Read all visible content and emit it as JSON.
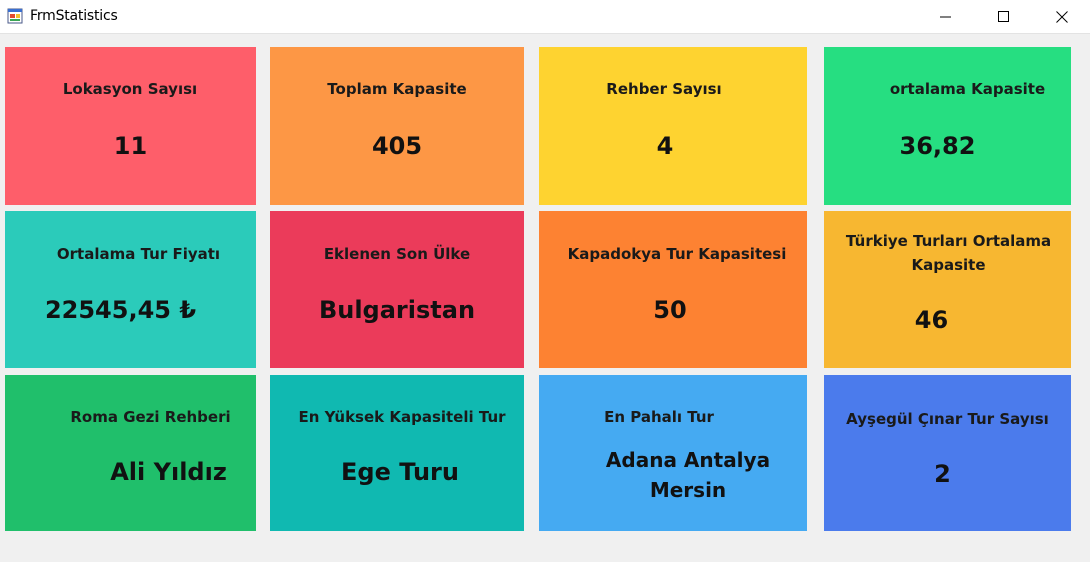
{
  "window": {
    "title": "FrmStatistics",
    "background": "#f0f0f0"
  },
  "cards": [
    {
      "label": "Lokasyon Sayısı",
      "value": "11",
      "color": "#fe5e6a"
    },
    {
      "label": "Toplam Kapasite",
      "value": "405",
      "color": "#fd9745"
    },
    {
      "label": "Rehber Sayısı",
      "value": "4",
      "color": "#fed330"
    },
    {
      "label": "ortalama Kapasite",
      "value": "36,82",
      "color": "#26de81"
    },
    {
      "label": "Ortalama Tur Fiyatı",
      "value": "22545,45 ₺",
      "color": "#2bcbba"
    },
    {
      "label": "Eklenen Son Ülke",
      "value": "Bulgaristan",
      "color": "#eb3b5a"
    },
    {
      "label": "Kapadokya Tur Kapasitesi",
      "value": "50",
      "color": "#fd8232"
    },
    {
      "label": "Türkiye Turları Ortalama Kapasite",
      "value": "46",
      "color": "#f7b731"
    },
    {
      "label": "Roma Gezi Rehberi",
      "value": "Ali Yıldız",
      "color": "#20bf6b"
    },
    {
      "label": "En Yüksek Kapasiteli Tur",
      "value": "Ege Turu",
      "color": "#10b9b1"
    },
    {
      "label": "En Pahalı Tur",
      "value": "Adana Antalya Mersin",
      "color": "#45aaf2"
    },
    {
      "label": "Ayşegül Çınar Tur Sayısı",
      "value": "2",
      "color": "#4b7bec"
    }
  ]
}
